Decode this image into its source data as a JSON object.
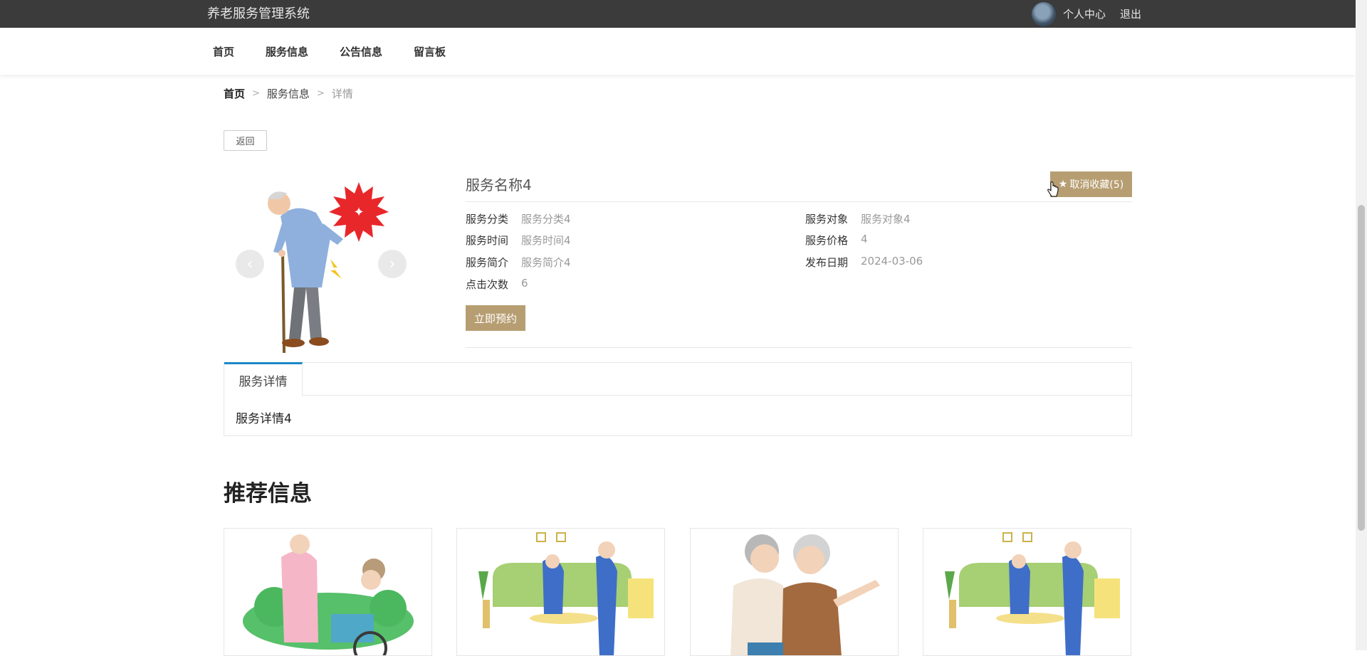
{
  "header": {
    "brand": "养老服务管理系统",
    "personal_center": "个人中心",
    "logout": "退出"
  },
  "nav": {
    "items": [
      "首页",
      "服务信息",
      "公告信息",
      "留言板"
    ]
  },
  "breadcrumb": {
    "home": "首页",
    "section": "服务信息",
    "current": "详情",
    "sep": ">"
  },
  "back_label": "返回",
  "carousel": {
    "prev": "‹",
    "next": "›"
  },
  "service": {
    "title": "服务名称4",
    "favorite_label": "取消收藏(5)",
    "fields": {
      "category": {
        "label": "服务分类",
        "value": "服务分类4"
      },
      "target": {
        "label": "服务对象",
        "value": "服务对象4"
      },
      "time": {
        "label": "服务时间",
        "value": "服务时间4"
      },
      "price": {
        "label": "服务价格",
        "value": "4"
      },
      "intro": {
        "label": "服务简介",
        "value": "服务简介4"
      },
      "publish_date": {
        "label": "发布日期",
        "value": "2024-03-06"
      },
      "clicks": {
        "label": "点击次数",
        "value": "6"
      }
    },
    "book_label": "立即预约"
  },
  "detail_tab": {
    "label": "服务详情",
    "content": "服务详情4"
  },
  "recommend": {
    "title": "推荐信息"
  },
  "colors": {
    "accent": "#b79e72",
    "topbar": "#3b3b3b",
    "tab_indicator": "#1e88c7"
  }
}
